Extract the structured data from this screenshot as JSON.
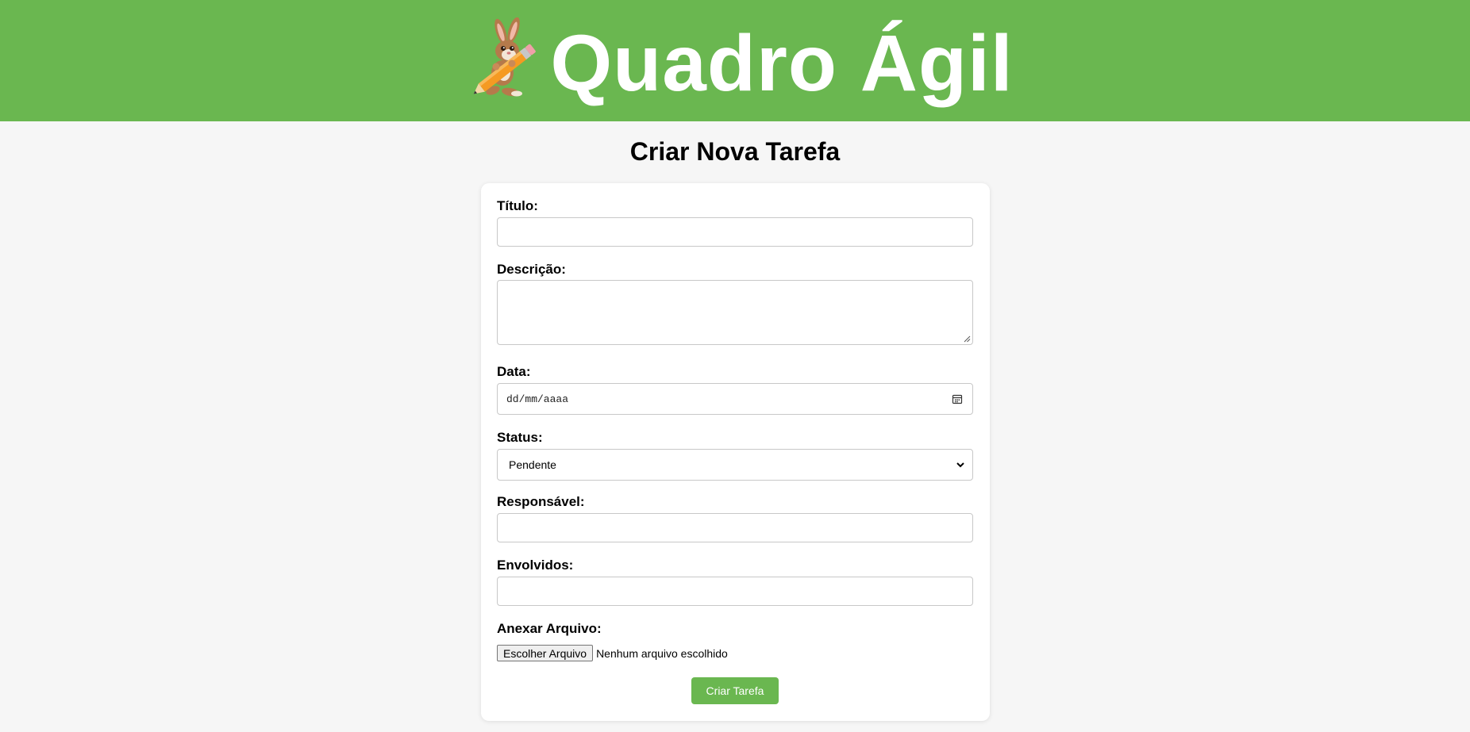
{
  "header": {
    "app_title": "Quadro Ágil",
    "logo_icon": "rabbit-pencil-logo",
    "background_color": "#6ab750"
  },
  "page": {
    "title": "Criar Nova Tarefa"
  },
  "form": {
    "titulo": {
      "label": "Título:",
      "value": ""
    },
    "descricao": {
      "label": "Descrição:",
      "value": ""
    },
    "data": {
      "label": "Data:",
      "placeholder": "dd/mm/aaaa",
      "icon": "calendar-icon"
    },
    "status": {
      "label": "Status:",
      "selected": "Pendente",
      "icon": "chevron-down-icon"
    },
    "responsavel": {
      "label": "Responsável:",
      "value": ""
    },
    "envolvidos": {
      "label": "Envolvidos:",
      "value": ""
    },
    "anexo": {
      "label": "Anexar Arquivo:",
      "button_label": "Escolher Arquivo",
      "status_text": "Nenhum arquivo escolhido"
    },
    "submit_label": "Criar Tarefa"
  },
  "colors": {
    "accent": "#6ab750",
    "page_background": "#f6f6f6",
    "card_background": "#ffffff"
  }
}
